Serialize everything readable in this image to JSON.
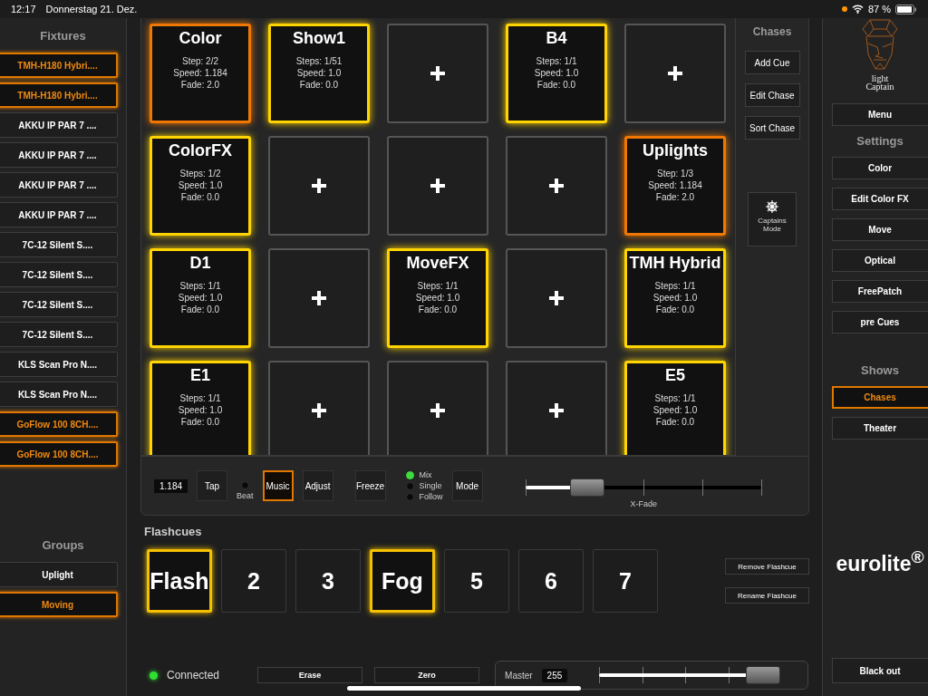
{
  "status_bar": {
    "time": "12:17",
    "date": "Donnerstag 21. Dez.",
    "battery": "87 %"
  },
  "fixtures": {
    "title": "Fixtures",
    "items": [
      {
        "label": "TMH-H180 Hybri....",
        "selected": true
      },
      {
        "label": "TMH-H180 Hybri....",
        "selected": true
      },
      {
        "label": "AKKU IP PAR 7 ....",
        "selected": false
      },
      {
        "label": "AKKU IP PAR 7 ....",
        "selected": false
      },
      {
        "label": "AKKU IP PAR 7 ....",
        "selected": false
      },
      {
        "label": "AKKU IP PAR 7 ....",
        "selected": false
      },
      {
        "label": "7C-12 Silent S....",
        "selected": false
      },
      {
        "label": "7C-12 Silent S....",
        "selected": false
      },
      {
        "label": "7C-12 Silent S....",
        "selected": false
      },
      {
        "label": "7C-12 Silent S....",
        "selected": false
      },
      {
        "label": "KLS Scan Pro N....",
        "selected": false
      },
      {
        "label": "KLS Scan Pro N....",
        "selected": false
      },
      {
        "label": "GoFlow 100 8CH....",
        "selected": true
      },
      {
        "label": "GoFlow 100 8CH....",
        "selected": true
      }
    ]
  },
  "groups": {
    "title": "Groups",
    "items": [
      {
        "label": "Uplight",
        "selected": false
      },
      {
        "label": "Moving",
        "selected": true
      }
    ]
  },
  "chase_grid": [
    {
      "kind": "chase",
      "title": "Color",
      "lines": [
        "Step: 2/2",
        "Speed: 1.184",
        "Fade: 2.0"
      ],
      "color": "#f07800"
    },
    {
      "kind": "chase",
      "title": "Show1",
      "lines": [
        "Steps: 1/51",
        "Speed: 1.0",
        "Fade: 0.0"
      ],
      "color": "#ffd400"
    },
    {
      "kind": "empty"
    },
    {
      "kind": "chase",
      "title": "B4",
      "lines": [
        "Steps: 1/1",
        "Speed: 1.0",
        "Fade: 0.0"
      ],
      "color": "#ffd400"
    },
    {
      "kind": "empty"
    },
    {
      "kind": "chase",
      "title": "ColorFX",
      "lines": [
        "Steps: 1/2",
        "Speed: 1.0",
        "Fade: 0.0"
      ],
      "color": "#ffd400"
    },
    {
      "kind": "empty"
    },
    {
      "kind": "empty"
    },
    {
      "kind": "empty"
    },
    {
      "kind": "chase",
      "title": "Uplights",
      "lines": [
        "Step: 1/3",
        "Speed: 1.184",
        "Fade: 2.0"
      ],
      "color": "#f07800"
    },
    {
      "kind": "chase",
      "title": "D1",
      "lines": [
        "Steps: 1/1",
        "Speed: 1.0",
        "Fade: 0.0"
      ],
      "color": "#ffd400"
    },
    {
      "kind": "empty"
    },
    {
      "kind": "chase",
      "title": "MoveFX",
      "lines": [
        "Steps: 1/1",
        "Speed: 1.0",
        "Fade: 0.0"
      ],
      "color": "#ffd400"
    },
    {
      "kind": "empty"
    },
    {
      "kind": "chase",
      "title": "TMH Hybrid",
      "lines": [
        "Steps: 1/1",
        "Speed: 1.0",
        "Fade: 0.0"
      ],
      "color": "#ffd400"
    },
    {
      "kind": "chase",
      "title": "E1",
      "lines": [
        "Steps: 1/1",
        "Speed: 1.0",
        "Fade: 0.0"
      ],
      "color": "#ffd400"
    },
    {
      "kind": "empty"
    },
    {
      "kind": "empty"
    },
    {
      "kind": "empty"
    },
    {
      "kind": "chase",
      "title": "E5",
      "lines": [
        "Steps: 1/1",
        "Speed: 1.0",
        "Fade: 0.0"
      ],
      "color": "#ffd400"
    }
  ],
  "chases_panel": {
    "title": "Chases",
    "buttons": [
      "Add Cue",
      "Edit Chase",
      "Sort Chase"
    ],
    "captains_mode": "Captains Mode"
  },
  "controls": {
    "speed": "1.184",
    "tap": "Tap",
    "beat": {
      "label": "Beat",
      "on": false
    },
    "buttons": [
      {
        "label": "Music",
        "selected": true
      },
      {
        "label": "Adjust",
        "selected": false
      },
      {
        "label": "Freeze",
        "selected": false
      }
    ],
    "modes": [
      {
        "label": "Mix",
        "selected": true
      },
      {
        "label": "Single",
        "selected": false
      },
      {
        "label": "Follow",
        "selected": false
      }
    ],
    "mode_button": "Mode",
    "xfade": {
      "label": "X-Fade",
      "level": 0.26
    }
  },
  "flashcues": {
    "title": "Flashcues",
    "items": [
      {
        "label": "Flash",
        "selected": true
      },
      {
        "label": "2",
        "selected": false
      },
      {
        "label": "3",
        "selected": false
      },
      {
        "label": "Fog",
        "selected": true
      },
      {
        "label": "5",
        "selected": false
      },
      {
        "label": "6",
        "selected": false
      },
      {
        "label": "7",
        "selected": false
      }
    ],
    "buttons": [
      "Remove Flashcue",
      "Rename Flashcue"
    ]
  },
  "footer": {
    "connection": {
      "label": "Connected",
      "on": true
    },
    "buttons": [
      "Erase",
      "Zero"
    ],
    "master": {
      "label": "Master",
      "value": "255",
      "level": 0.95
    }
  },
  "right_sidebar": {
    "logo": "light Captain",
    "menu": "Menu",
    "settings_title": "Settings",
    "settings": [
      "Color",
      "Edit Color FX",
      "Move",
      "Optical",
      "FreePatch",
      "pre Cues"
    ],
    "shows_title": "Shows",
    "shows": [
      {
        "label": "Chases",
        "selected": true
      },
      {
        "label": "Theater",
        "selected": false
      }
    ],
    "brand": "eurolite$^{®}$",
    "blackout": "Black out"
  }
}
